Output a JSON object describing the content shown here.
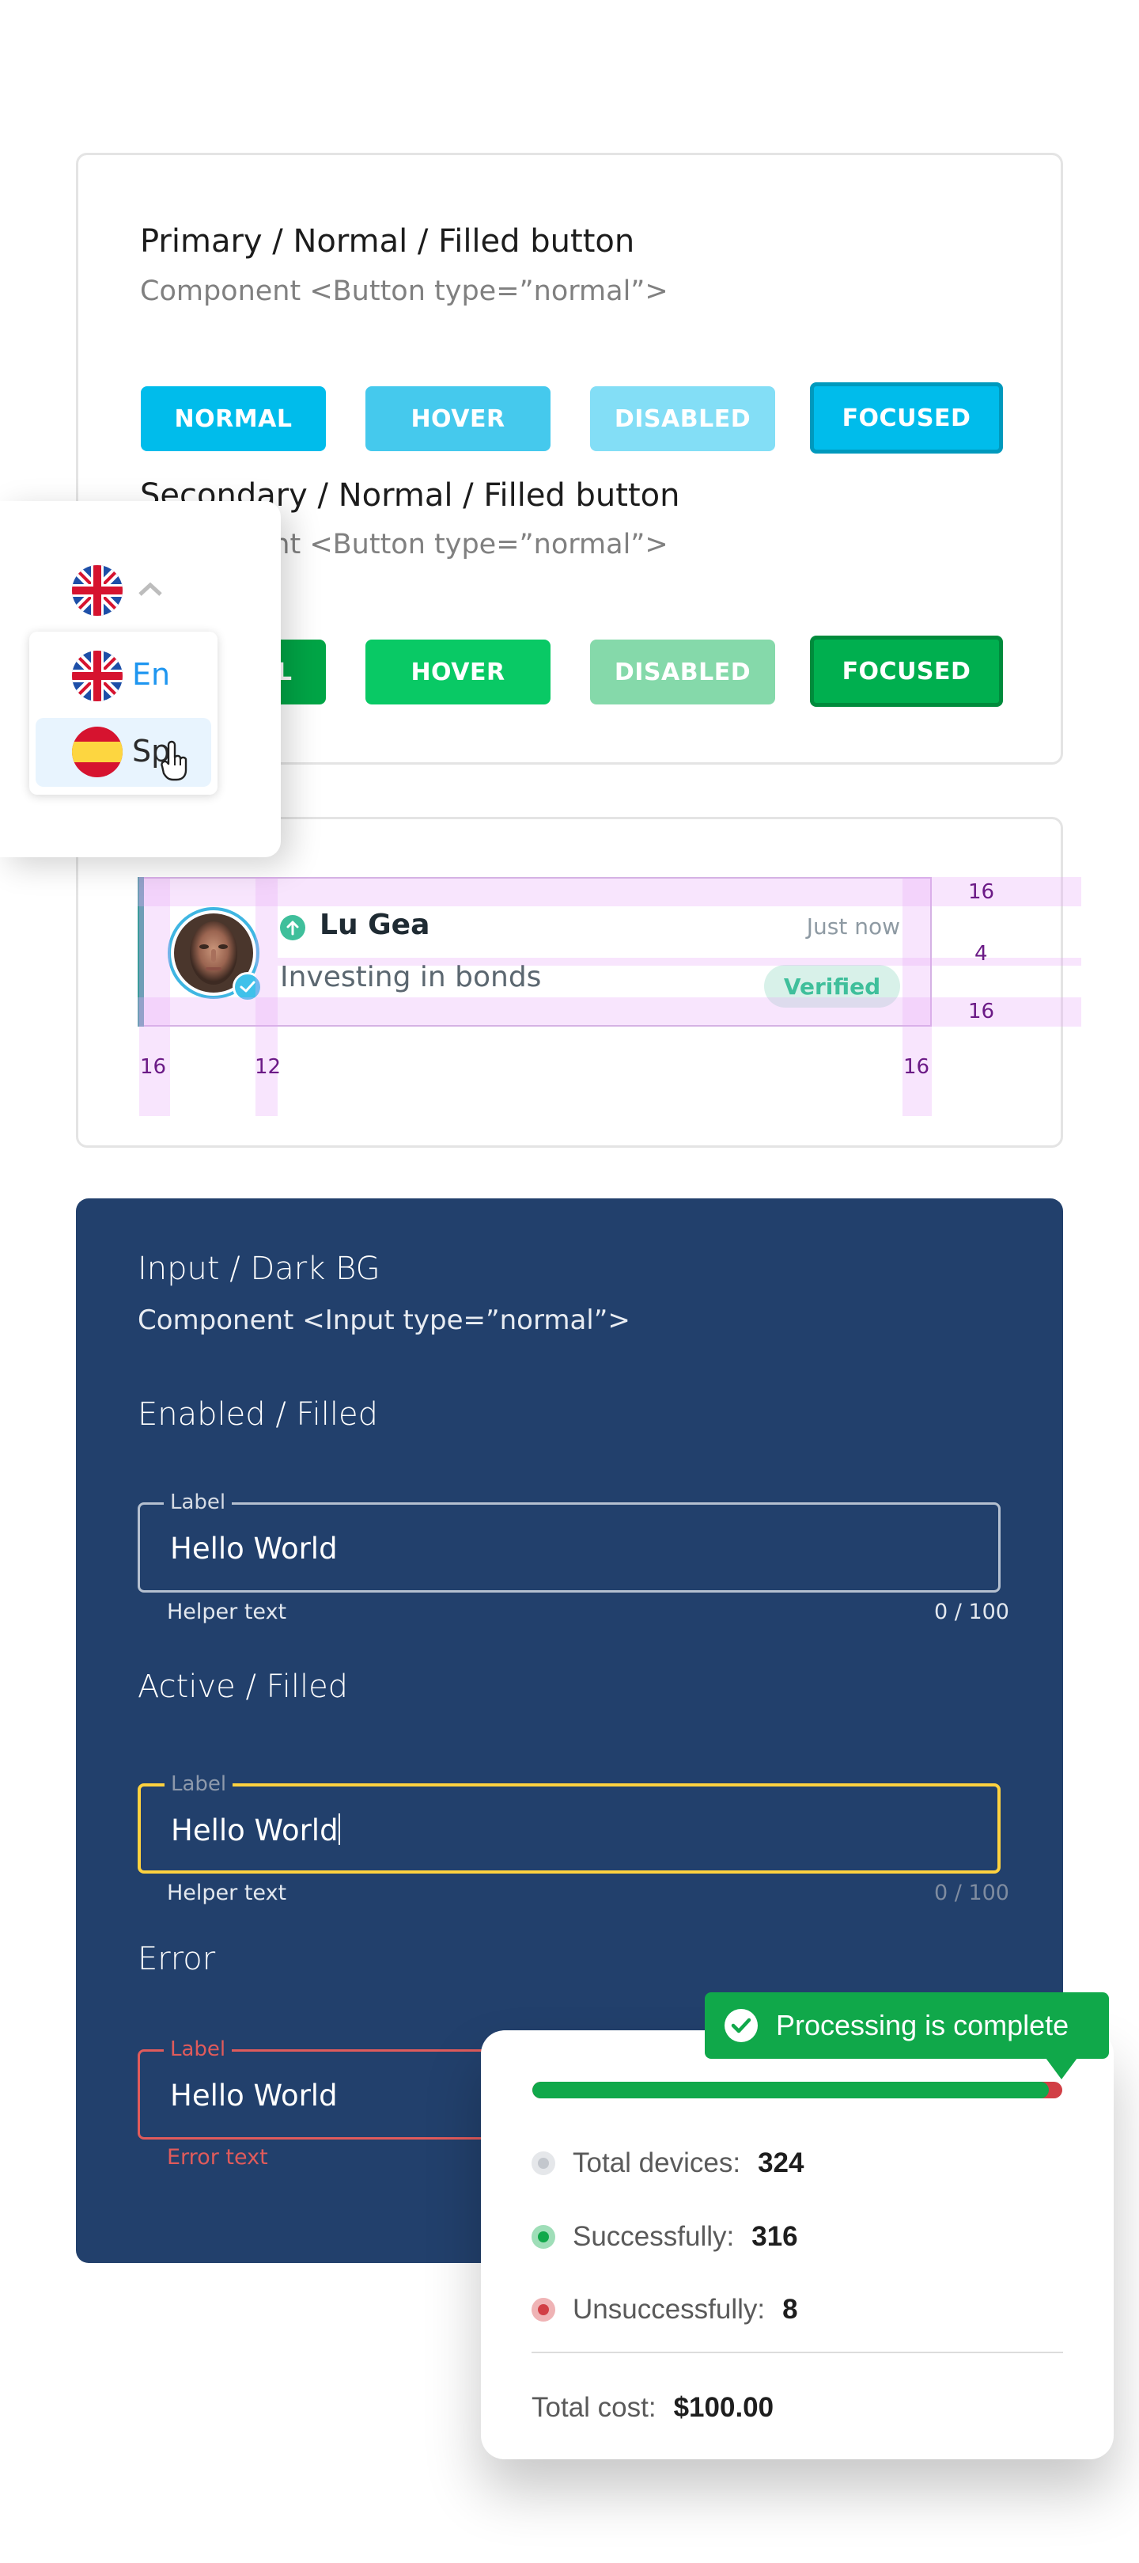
{
  "primary_section": {
    "title": "Primary / Normal /  Filled button",
    "subtitle": "Component <Button type=”normal”>",
    "buttons": [
      {
        "label": "NORMAL",
        "state": "normal",
        "color": "#00bceb"
      },
      {
        "label": "HOVER",
        "state": "hover",
        "color": "#45c9ed"
      },
      {
        "label": "DISABLED",
        "state": "disabled",
        "color": "#83def6"
      },
      {
        "label": "FOCUSED",
        "state": "focused",
        "color": "#00bceb",
        "border": "#0099bd"
      }
    ]
  },
  "secondary_section": {
    "title": "Secondary / Normal /  Filled button",
    "subtitle": "Component <Button type=”normal”>",
    "buttons": [
      {
        "label": "NORMAL",
        "state": "normal",
        "color": "#00a546"
      },
      {
        "label": "HOVER",
        "state": "hover",
        "color": "#09c965"
      },
      {
        "label": "DISABLED",
        "state": "disabled",
        "color": "#85d9aa"
      },
      {
        "label": "FOCUSED",
        "state": "focused",
        "color": "#00af4f",
        "border": "#008b3c"
      }
    ]
  },
  "language_picker": {
    "selected_flag": "uk-flag-icon",
    "chevron": "chevron-up-icon",
    "options": [
      {
        "label": "En",
        "flag": "uk-flag-icon",
        "selected": true
      },
      {
        "label": "Sp",
        "flag": "spain-flag-icon",
        "hovered": true
      }
    ],
    "cursor": "hand-pointer-icon"
  },
  "list_item": {
    "name": "Lu Gea",
    "time": "Just now",
    "description": "Investing in bonds",
    "badge": "Verified",
    "trend_icon": "arrow-up-circle-icon",
    "verified_icon": "check-badge-icon",
    "accent_color": "#3fbf9b",
    "spacing_annotations": {
      "top": "16",
      "gap": "4",
      "bottom": "16",
      "left": "16",
      "avatar_gap": "12",
      "right": "16"
    }
  },
  "input_section": {
    "title": "Input / Dark BG",
    "subtitle": "Component <Input type=”normal”>",
    "background": "#22406c",
    "states": [
      {
        "heading": "Enabled / Filled",
        "label": "Label",
        "value": "Hello World",
        "helper": "Helper text",
        "counter": "0 / 100",
        "border_color": "#b5c0d0"
      },
      {
        "heading": "Active / Filled",
        "label": "Label",
        "value": "Hello World",
        "helper": "Helper text",
        "counter": "0 / 100",
        "border_color": "#ffd23f"
      },
      {
        "heading": "Error",
        "label": "Label",
        "value": "Hello World",
        "helper": "Error text",
        "border_color": "#e05b5b"
      }
    ]
  },
  "processing": {
    "tooltip": "Processing is complete",
    "progress": {
      "success_fraction": 0.975,
      "fail_fraction": 0.025
    },
    "rows": [
      {
        "label": "Total devices:",
        "value": "324",
        "dot": "grey"
      },
      {
        "label": "Successfully:",
        "value": "316",
        "dot": "green"
      },
      {
        "label": "Unsuccessfully:",
        "value": "8",
        "dot": "red"
      }
    ],
    "total_label": "Total cost:",
    "total_value": "$100.00",
    "colors": {
      "success": "#10a84a",
      "fail": "#d13f45"
    }
  }
}
